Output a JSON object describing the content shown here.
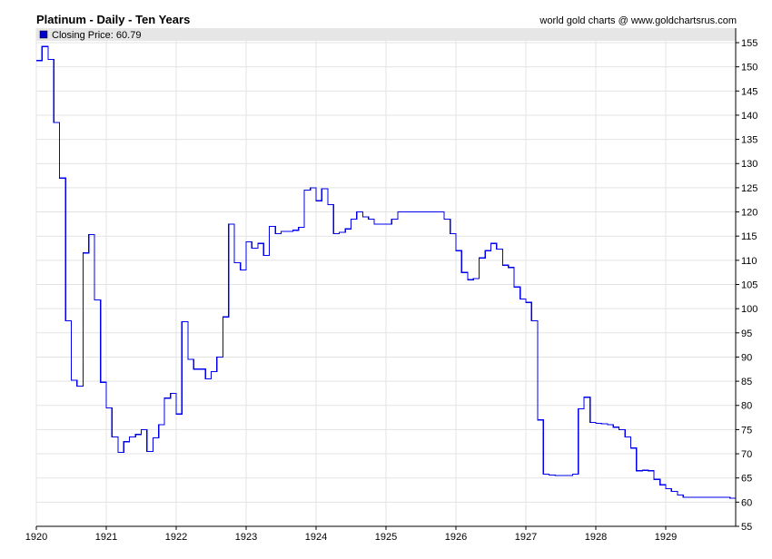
{
  "header": {
    "title": "Platinum - Daily - Ten Years",
    "credit": "world gold charts @ www.goldchartsrus.com"
  },
  "legend": {
    "label": "Closing Price: 60.79",
    "swatch_color": "#0000cc"
  },
  "colors": {
    "line": "#0000ee",
    "grid": "#e3e3e3",
    "legend_bg": "#e6e6e6",
    "axis": "#000000"
  },
  "chart_data": {
    "type": "line",
    "title": "Platinum - Daily - Ten Years",
    "series": [
      {
        "name": "Closing Price",
        "step": true,
        "x": [
          1920.0,
          1920.08,
          1920.17,
          1920.25,
          1920.33,
          1920.42,
          1920.5,
          1920.58,
          1920.67,
          1920.75,
          1920.83,
          1920.92,
          1921.0,
          1921.08,
          1921.17,
          1921.25,
          1921.33,
          1921.42,
          1921.5,
          1921.58,
          1921.67,
          1921.75,
          1921.83,
          1921.92,
          1922.0,
          1922.08,
          1922.17,
          1922.25,
          1922.33,
          1922.42,
          1922.5,
          1922.58,
          1922.67,
          1922.75,
          1922.83,
          1922.92,
          1923.0,
          1923.08,
          1923.17,
          1923.25,
          1923.33,
          1923.42,
          1923.5,
          1923.58,
          1923.67,
          1923.75,
          1923.83,
          1923.92,
          1924.0,
          1924.08,
          1924.17,
          1924.25,
          1924.33,
          1924.42,
          1924.5,
          1924.58,
          1924.67,
          1924.75,
          1924.83,
          1924.92,
          1925.0,
          1925.08,
          1925.17,
          1925.25,
          1925.33,
          1925.42,
          1925.5,
          1925.58,
          1925.67,
          1925.75,
          1925.83,
          1925.92,
          1926.0,
          1926.08,
          1926.17,
          1926.25,
          1926.33,
          1926.42,
          1926.5,
          1926.58,
          1926.67,
          1926.75,
          1926.83,
          1926.92,
          1927.0,
          1927.08,
          1927.17,
          1927.25,
          1927.33,
          1927.42,
          1927.5,
          1927.58,
          1927.67,
          1927.75,
          1927.83,
          1927.92,
          1928.0,
          1928.08,
          1928.17,
          1928.25,
          1928.33,
          1928.42,
          1928.5,
          1928.58,
          1928.67,
          1928.75,
          1928.83,
          1928.92,
          1929.0,
          1929.08,
          1929.17,
          1929.25,
          1929.33,
          1929.42,
          1929.5,
          1929.58,
          1929.67,
          1929.75,
          1929.83,
          1929.92
        ],
        "values": [
          151.3,
          154.2,
          151.5,
          138.5,
          127.0,
          97.5,
          85.2,
          84.0,
          111.5,
          115.3,
          101.8,
          84.8,
          79.5,
          73.5,
          70.3,
          72.5,
          73.5,
          74.0,
          75.0,
          70.5,
          73.3,
          76.0,
          81.5,
          82.5,
          78.2,
          97.3,
          89.5,
          87.5,
          87.5,
          85.5,
          87.0,
          90.0,
          98.3,
          117.5,
          109.5,
          108.0,
          113.8,
          112.5,
          113.5,
          111.0,
          117.0,
          115.5,
          116.0,
          116.0,
          116.2,
          116.8,
          124.5,
          125.0,
          122.3,
          124.8,
          121.5,
          115.5,
          115.8,
          116.5,
          118.5,
          120.0,
          119.0,
          118.5,
          117.5,
          117.5,
          117.5,
          118.5,
          120.0,
          120.0,
          120.0,
          120.0,
          120.0,
          120.0,
          120.0,
          120.0,
          118.5,
          115.5,
          112.0,
          107.5,
          106.0,
          106.2,
          110.5,
          112.0,
          113.5,
          112.3,
          109.0,
          108.5,
          104.5,
          102.0,
          101.3,
          97.5,
          77.0,
          65.8,
          65.6,
          65.5,
          65.5,
          65.5,
          65.8,
          79.3,
          81.7,
          76.5,
          76.3,
          76.2,
          76.0,
          75.5,
          75.0,
          73.5,
          71.2,
          66.5,
          66.6,
          66.5,
          64.7,
          63.6,
          62.8,
          62.2,
          61.5,
          61.0,
          61.0,
          61.0,
          61.0,
          61.0,
          61.0,
          61.0,
          61.0,
          60.79
        ]
      }
    ],
    "xlim": [
      1920,
      1930
    ],
    "ylim": [
      55,
      158
    ],
    "x_ticks": [
      "1920",
      "1921",
      "1922",
      "1923",
      "1924",
      "1925",
      "1926",
      "1927",
      "1928",
      "1929"
    ],
    "y_ticks": [
      55,
      60,
      65,
      70,
      75,
      80,
      85,
      90,
      95,
      100,
      105,
      110,
      115,
      120,
      125,
      130,
      135,
      140,
      145,
      150,
      155
    ],
    "y_axis_side": "right",
    "grid": true,
    "legend_position": "top-left"
  }
}
